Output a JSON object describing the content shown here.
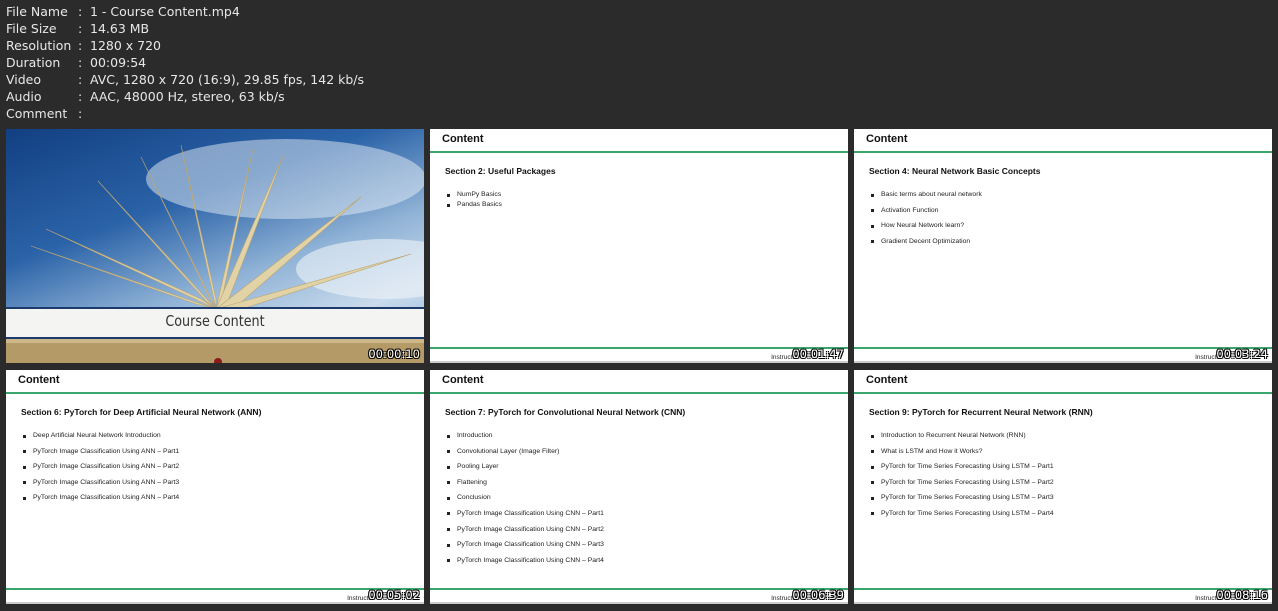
{
  "info": [
    {
      "key": "File Name",
      "value": "1 - Course Content.mp4"
    },
    {
      "key": "File Size",
      "value": "14.63 MB"
    },
    {
      "key": "Resolution",
      "value": "1280 x 720"
    },
    {
      "key": "Duration",
      "value": "00:09:54"
    },
    {
      "key": "Video",
      "value": "AVC, 1280 x 720 (16:9), 29.85 fps, 142 kb/s"
    },
    {
      "key": "Audio",
      "value": "AAC, 48000 Hz, stereo, 63 kb/s"
    },
    {
      "key": "Comment",
      "value": ""
    }
  ],
  "separator": ":",
  "cover": {
    "title": "Course Content",
    "timestamp": "00:00:10"
  },
  "slides": [
    {
      "title": "Content",
      "section": "Section 2: Useful Packages",
      "items": [
        "NumPy Basics",
        "Pandas Basics"
      ],
      "instructor": "Instructor:",
      "timestamp": "00:01:47"
    },
    {
      "title": "Content",
      "section": "Section 4: Neural Network Basic Concepts",
      "items": [
        "Basic terms about neural network",
        "Activation Function",
        "How Neural Network learn?",
        "Gradient Decent Optimization"
      ],
      "instructor": "Instructor:",
      "timestamp": "00:03:24"
    },
    {
      "title": "Content",
      "section": "Section 6: PyTorch for Deep Artificial Neural Network (ANN)",
      "items": [
        "Deep Artificial Neural Network Introduction",
        "PyTorch Image Classification Using ANN – Part1",
        "PyTorch Image Classification Using ANN – Part2",
        "PyTorch Image Classification Using ANN – Part3",
        "PyTorch Image Classification Using ANN – Part4"
      ],
      "instructor": "Instructor:",
      "timestamp": "00:05:02"
    },
    {
      "title": "Content",
      "section": "Section 7: PyTorch for Convolutional Neural Network (CNN)",
      "items": [
        "Introduction",
        "Convolutional Layer (Image Filter)",
        "Pooling Layer",
        "Flattening",
        "Conclusion",
        "PyTorch Image Classification Using CNN – Part1",
        "PyTorch Image Classification Using CNN – Part2",
        "PyTorch Image Classification Using CNN – Part3",
        "PyTorch Image Classification Using CNN – Part4"
      ],
      "instructor": "Instructor:",
      "timestamp": "00:06:39"
    },
    {
      "title": "Content",
      "section": "Section 9: PyTorch for Recurrent Neural Network (RNN)",
      "items": [
        "Introduction to Recurrent Neural Network (RNN)",
        "What is LSTM and How it Works?",
        "PyTorch for Time Series Forecasting Using LSTM – Part1",
        "PyTorch for Time Series Forecasting Using LSTM – Part2",
        "PyTorch for Time Series Forecasting Using LSTM – Part3",
        "PyTorch for Time Series Forecasting Using LSTM – Part4"
      ],
      "instructor": "Instructor:",
      "timestamp": "00:08:16"
    }
  ]
}
